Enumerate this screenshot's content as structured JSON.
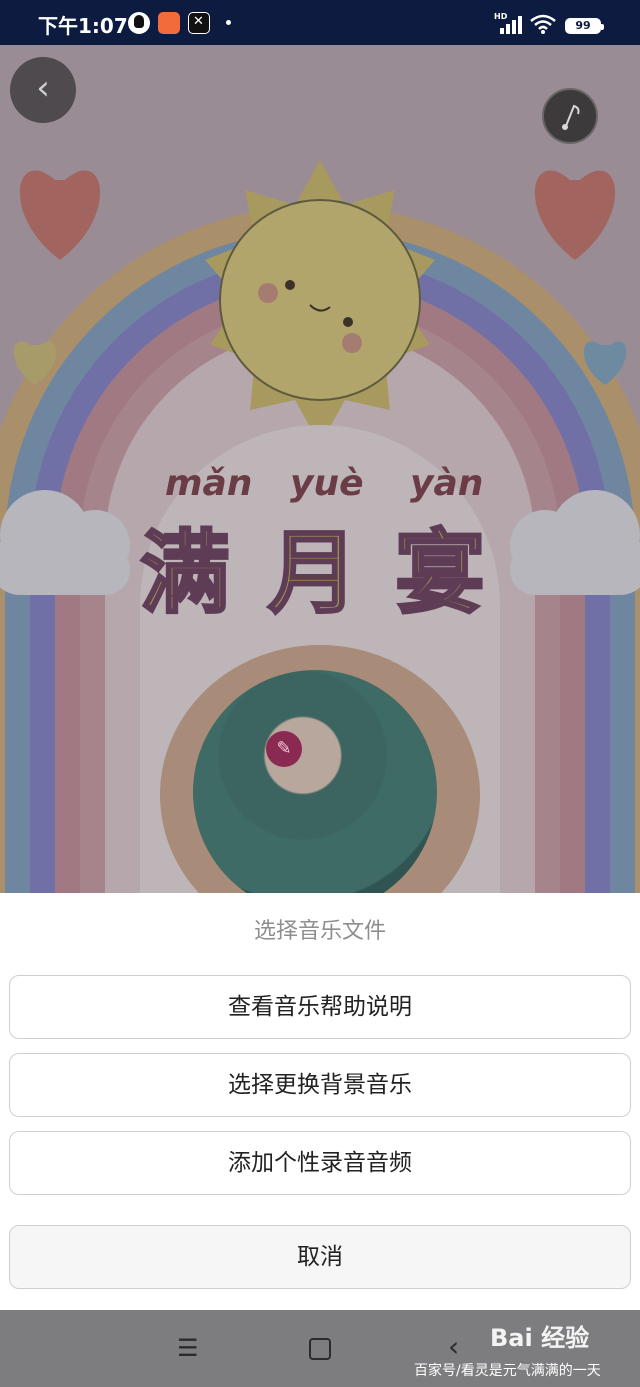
{
  "status_bar": {
    "time": "下午1:07",
    "network": "HD",
    "battery": "99"
  },
  "poster": {
    "pinyin": [
      "mǎn",
      "yuè",
      "yàn"
    ],
    "title_chars": [
      "满",
      "月",
      "宴"
    ],
    "back_glyph": "‹",
    "music_icon": "music-note-icon",
    "edit_icon": "pencil-icon"
  },
  "sheet": {
    "title": "选择音乐文件",
    "options": [
      {
        "label": "查看音乐帮助说明"
      },
      {
        "label": "选择更换背景音乐"
      },
      {
        "label": "添加个性录音音频"
      }
    ],
    "cancel_label": "取消"
  },
  "nav_bar": {
    "menu_glyph": "☰",
    "back_glyph": "‹"
  },
  "watermark": {
    "logo": "Bai 经验",
    "text": "百家号/看灵是元气满满的一天"
  },
  "colors": {
    "status_bar_bg": "#0c1b3f",
    "sheet_bg": "#ffffff",
    "overlay": "#7d7d7f"
  }
}
